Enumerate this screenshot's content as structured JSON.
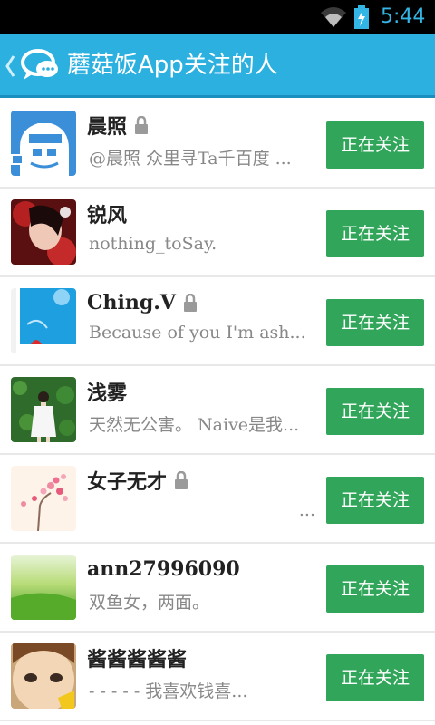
{
  "status_bar": {
    "time": "5:44"
  },
  "header": {
    "title": "蘑菇饭App关注的人"
  },
  "users": [
    {
      "name": "晨照",
      "locked": true,
      "bio": "@晨照  众里寻Ta千百度 ...",
      "button": "正在关注"
    },
    {
      "name": "锐风",
      "locked": false,
      "bio": "nothing_toSay.",
      "button": "正在关注"
    },
    {
      "name": "Ching.V",
      "locked": true,
      "bio": "Because of you I'm ash...",
      "button": "正在关注"
    },
    {
      "name": "浅雾",
      "locked": false,
      "bio": "天然无公害。  Naive是我...",
      "button": "正在关注"
    },
    {
      "name": "女子无才",
      "locked": true,
      "bio": "...",
      "button": "正在关注"
    },
    {
      "name": "ann27996090",
      "locked": false,
      "bio": "双鱼女，两面。",
      "button": "正在关注"
    },
    {
      "name": "酱酱酱酱酱",
      "locked": false,
      "bio": "- - - - -   我喜欢钱喜...",
      "button": "正在关注"
    }
  ],
  "colors": {
    "accent": "#2cb0e0",
    "follow": "#31a65a",
    "status_time": "#33b5e5"
  }
}
